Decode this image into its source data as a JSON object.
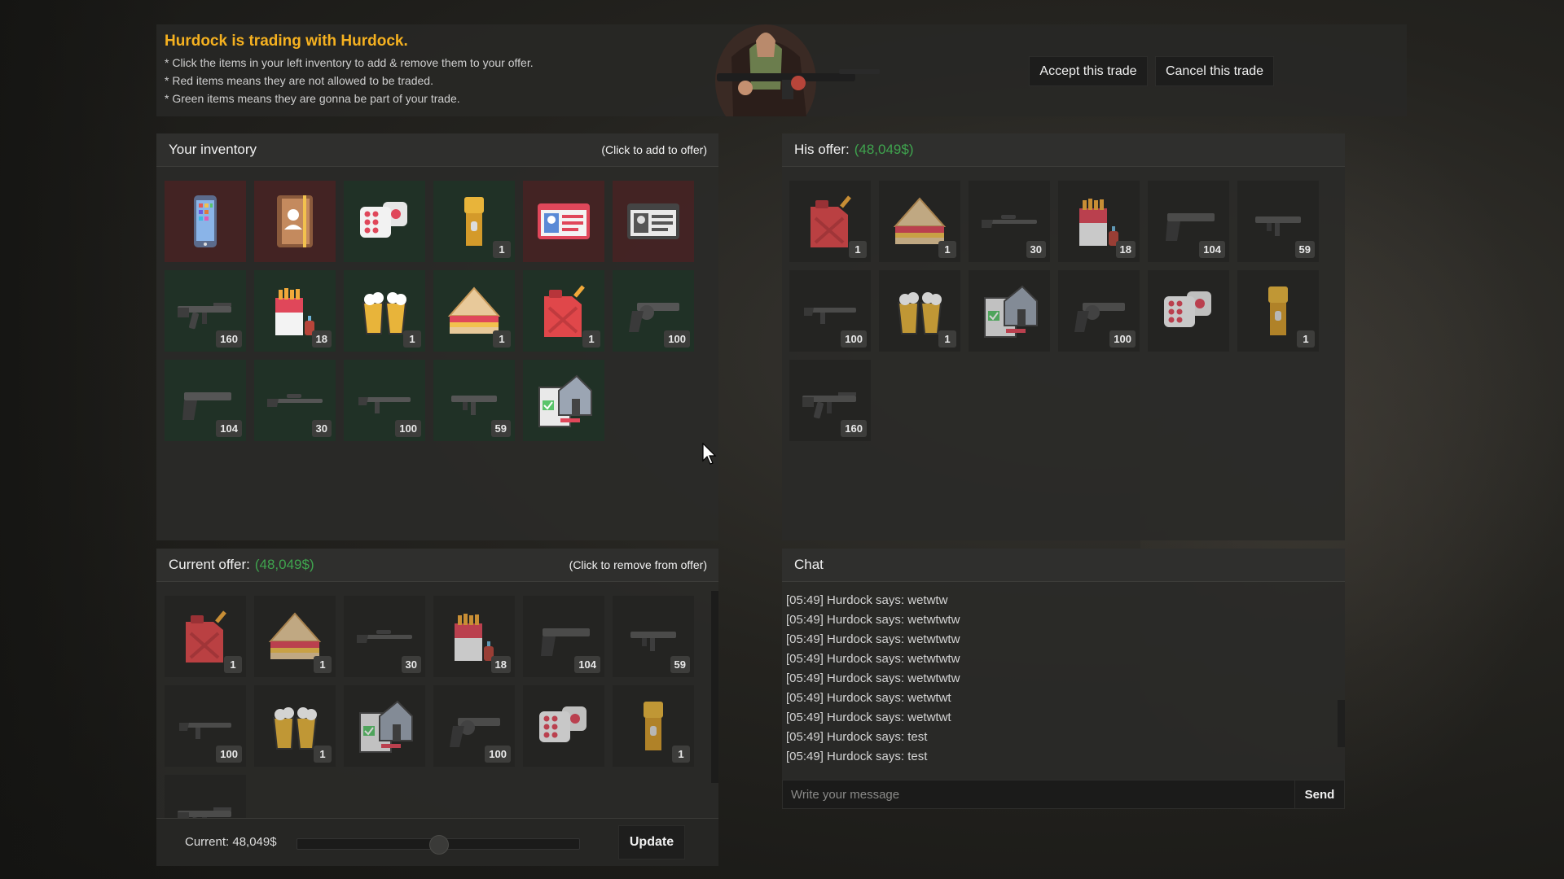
{
  "header": {
    "title": "Hurdock is trading with Hurdock.",
    "lines": [
      "* Click the items in your left inventory to add & remove them to your offer.",
      "* Red items means they are not allowed to be traded.",
      "* Green items means they are gonna be part of your trade."
    ],
    "accept_label": "Accept this trade",
    "cancel_label": "Cancel this trade"
  },
  "inventory": {
    "title": "Your inventory",
    "hint": "(Click to add to offer)",
    "items": [
      {
        "icon": "phone-icon",
        "count": "",
        "status": "red"
      },
      {
        "icon": "contact-book-icon",
        "count": "",
        "status": "red"
      },
      {
        "icon": "dice-icon",
        "count": "",
        "status": "green"
      },
      {
        "icon": "flashlight-icon",
        "count": "1",
        "status": "green"
      },
      {
        "icon": "id-card-icon",
        "count": "",
        "status": "red"
      },
      {
        "icon": "license-card-icon",
        "count": "",
        "status": "red"
      },
      {
        "icon": "assault-rifle-icon",
        "count": "160",
        "status": "green"
      },
      {
        "icon": "cigarettes-icon",
        "count": "18",
        "status": "green"
      },
      {
        "icon": "beer-mugs-icon",
        "count": "1",
        "status": "green"
      },
      {
        "icon": "sandwich-icon",
        "count": "1",
        "status": "green"
      },
      {
        "icon": "jerrycan-icon",
        "count": "1",
        "status": "green"
      },
      {
        "icon": "revolver-icon",
        "count": "100",
        "status": "green"
      },
      {
        "icon": "pistol-icon",
        "count": "104",
        "status": "green"
      },
      {
        "icon": "sniper-rifle-icon",
        "count": "30",
        "status": "green"
      },
      {
        "icon": "carbine-icon",
        "count": "100",
        "status": "green"
      },
      {
        "icon": "smg-icon",
        "count": "59",
        "status": "green"
      },
      {
        "icon": "house-deed-icon",
        "count": "",
        "status": "green"
      }
    ]
  },
  "his_offer": {
    "title": "His offer:",
    "amount": "(48,049$)",
    "items": [
      {
        "icon": "jerrycan-icon",
        "count": "1"
      },
      {
        "icon": "sandwich-icon",
        "count": "1"
      },
      {
        "icon": "sniper-rifle-icon",
        "count": "30"
      },
      {
        "icon": "cigarettes-icon",
        "count": "18"
      },
      {
        "icon": "pistol-icon",
        "count": "104"
      },
      {
        "icon": "smg-icon",
        "count": "59"
      },
      {
        "icon": "carbine-icon",
        "count": "100"
      },
      {
        "icon": "beer-mugs-icon",
        "count": "1"
      },
      {
        "icon": "house-deed-icon",
        "count": ""
      },
      {
        "icon": "revolver-icon",
        "count": "100"
      },
      {
        "icon": "dice-icon",
        "count": ""
      },
      {
        "icon": "flashlight-icon",
        "count": "1"
      },
      {
        "icon": "assault-rifle-icon",
        "count": "160"
      }
    ]
  },
  "current_offer": {
    "title": "Current offer:",
    "amount": "(48,049$)",
    "hint": "(Click to remove from offer)",
    "items": [
      {
        "icon": "jerrycan-icon",
        "count": "1"
      },
      {
        "icon": "sandwich-icon",
        "count": "1"
      },
      {
        "icon": "sniper-rifle-icon",
        "count": "30"
      },
      {
        "icon": "cigarettes-icon",
        "count": "18"
      },
      {
        "icon": "pistol-icon",
        "count": "104"
      },
      {
        "icon": "smg-icon",
        "count": "59"
      },
      {
        "icon": "carbine-icon",
        "count": "100"
      },
      {
        "icon": "beer-mugs-icon",
        "count": "1"
      },
      {
        "icon": "house-deed-icon",
        "count": ""
      },
      {
        "icon": "revolver-icon",
        "count": "100"
      },
      {
        "icon": "dice-icon",
        "count": ""
      },
      {
        "icon": "flashlight-icon",
        "count": "1"
      },
      {
        "icon": "assault-rifle-icon",
        "count": ""
      }
    ],
    "current_label": "Current: 48,049$",
    "slider_value": 0.5,
    "update_label": "Update"
  },
  "chat": {
    "title": "Chat",
    "messages": [
      "[05:49] Hurdock says: wetwtw",
      "[05:49] Hurdock says: wetwtwtw",
      "[05:49] Hurdock says: wetwtwtw",
      "[05:49] Hurdock says: wetwtwtw",
      "[05:49] Hurdock says: wetwtwtw",
      "[05:49] Hurdock says: wetwtwt",
      "[05:49] Hurdock says: wetwtwt",
      "[05:49] Hurdock says: test",
      "[05:49] Hurdock says: test"
    ],
    "placeholder": "Write your message",
    "send_label": "Send"
  },
  "colors": {
    "title_accent": "#f5b120",
    "money_green": "#3fa44e",
    "slot_red": "#462224",
    "slot_green": "#203226"
  }
}
